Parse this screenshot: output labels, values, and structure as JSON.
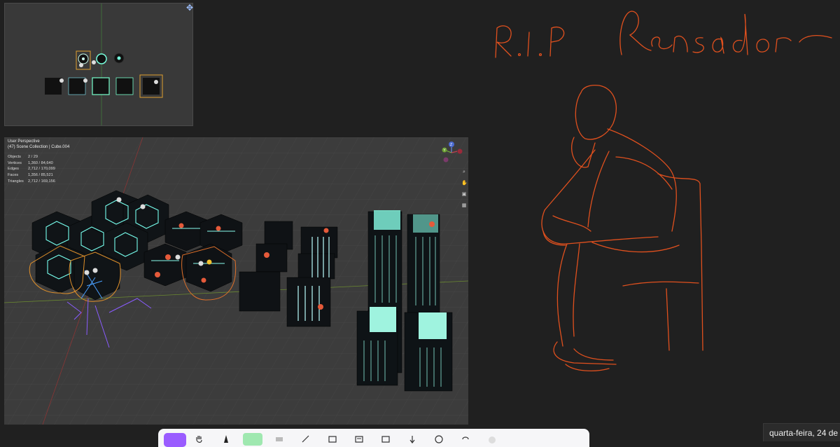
{
  "top_view": {
    "pin_icon": "pin-icon"
  },
  "viewport": {
    "perspective_label": "User Perspective",
    "collection_label": "(47) Scene Collection | Cube.004",
    "stats": [
      {
        "key": "Objects",
        "value": "2 / 29"
      },
      {
        "key": "Vertices",
        "value": "1,360 / 84,640"
      },
      {
        "key": "Edges",
        "value": "2,712 / 170,099"
      },
      {
        "key": "Faces",
        "value": "1,356 / 85,521"
      },
      {
        "key": "Triangles",
        "value": "2,712 / 169,156"
      }
    ],
    "gizmo_axes": {
      "y": "Y",
      "z": "Z"
    }
  },
  "sketch": {
    "title": "R.I.P Pensador",
    "ink_color": "#e0501e"
  },
  "toolbar": {
    "items": [
      "select-tool",
      "hand-tool",
      "pen-tool",
      "highlighter-tool",
      "eraser-tool",
      "ruler-tool",
      "shapes-tool",
      "text-tool",
      "image-tool",
      "touch-tool",
      "lasso-tool",
      "undo-tool",
      "more-tool"
    ],
    "accent": "#9a5cff"
  },
  "taskbar": {
    "date": "quarta-feira, 24 de"
  }
}
